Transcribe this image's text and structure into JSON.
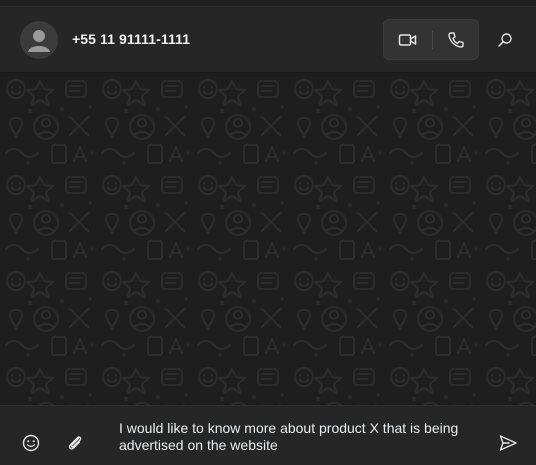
{
  "header": {
    "contact_name": "+55 11 91111-1111",
    "avatar_icon": "person-icon",
    "video_call_icon": "video-camera-icon",
    "voice_call_icon": "phone-icon",
    "search_icon": "search-icon"
  },
  "composer": {
    "message_text": "I would like to know more about product X that is being advertised on the website",
    "emoji_icon": "emoji-icon",
    "attach_icon": "paperclip-icon",
    "send_icon": "send-icon"
  },
  "colors": {
    "background": "#1e1e1e",
    "header": "#262626",
    "text": "#e9edef"
  }
}
